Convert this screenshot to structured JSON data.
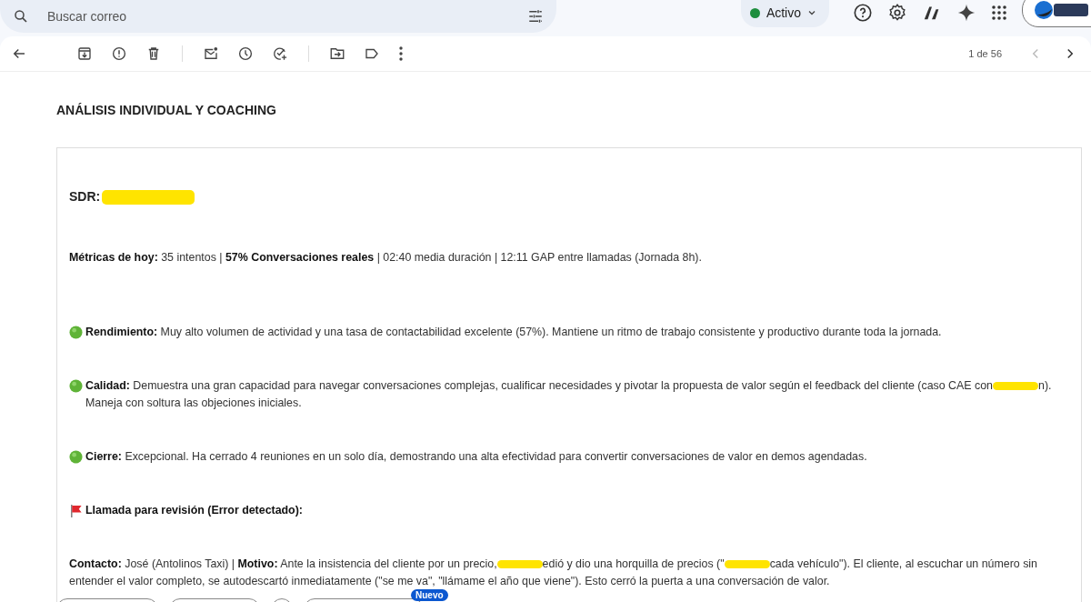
{
  "search": {
    "placeholder": "Buscar correo"
  },
  "status": {
    "label": "Activo",
    "color": "#1e8e3e"
  },
  "pager": {
    "text": "1 de 56",
    "prev_disabled": true,
    "next_disabled": false
  },
  "email": {
    "title": "ANÁLISIS INDIVIDUAL Y COACHING",
    "sdr": [
      {
        "kind": "text",
        "text": "SDR:"
      },
      {
        "kind": "redacted"
      }
    ],
    "paragraphs": [
      {
        "kind": "plain",
        "parts": [
          {
            "kind": "text",
            "text": "**Métricas de hoy:** 35 intentos | **57% Conversaciones reales** | 02:40 media duración | 12:11 GAP entre llamadas (Jornada 8h)."
          }
        ]
      },
      {
        "kind": "status",
        "parts": [
          {
            "kind": "text",
            "text": "**Rendimiento:** Muy alto volumen de actividad y una tasa de contactabilidad excelente (57%). Mantiene un ritmo de trabajo consistente y productivo durante toda la jornada."
          }
        ]
      },
      {
        "kind": "status",
        "parts": [
          {
            "kind": "text",
            "text": "**Calidad:** Demuestra una gran capacidad para navegar conversaciones complejas, cualificar necesidades y pivotar la propuesta de valor según el feedback del cliente (caso CAE con"
          },
          {
            "kind": "redacted"
          },
          {
            "kind": "text",
            "text": "n). Maneja con soltura las objeciones iniciales."
          }
        ]
      },
      {
        "kind": "status",
        "parts": [
          {
            "kind": "text",
            "text": "**Cierre:** Excepcional. Ha cerrado 4 reuniones en un solo día, demostrando una alta efectividad para convertir conversaciones de valor en demos agendadas."
          }
        ]
      },
      {
        "kind": "flag",
        "parts": [
          {
            "kind": "text",
            "text": "**Llamada para revisión (Error detectado):**"
          }
        ]
      },
      {
        "kind": "plain",
        "parts": [
          {
            "kind": "text",
            "text": "**Contacto:** José (Antolinos Taxi) | **Motivo:** Ante la insistencia del cliente por un precio,"
          },
          {
            "kind": "redacted"
          },
          {
            "kind": "text",
            "text": "edió y dio una horquilla de precios (\""
          },
          {
            "kind": "redacted"
          },
          {
            "kind": "text",
            "text": "cada vehículo\"). El cliente, al escuchar un número sin entender el valor completo, se autodescartó inmediatamente (\"se me va\", \"llámame el año que viene\"). Esto cerró la puerta a una conversación de valor."
          }
        ]
      }
    ]
  },
  "bottom": {
    "badge": "Nuevo"
  }
}
